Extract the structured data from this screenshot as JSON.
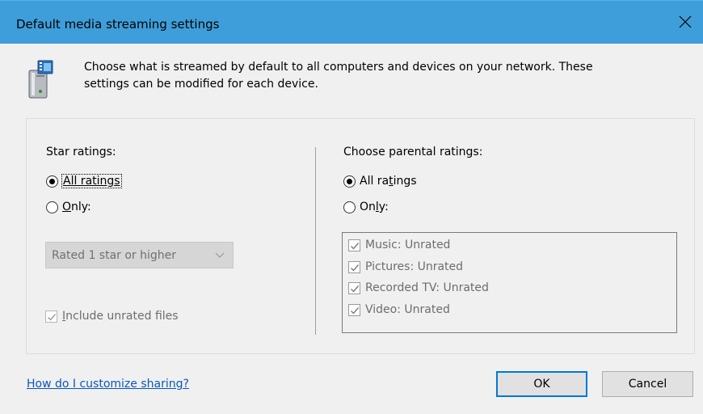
{
  "window": {
    "title": "Default media streaming settings",
    "close_glyph": "✕"
  },
  "header": {
    "icon": "media-device-icon",
    "description_line1": "Choose what is streamed by default to all computers and devices on your network.  These",
    "description_line2": "settings can be modified for each device."
  },
  "star_ratings": {
    "label": "Star ratings:",
    "all_ratings": "All ratings",
    "only": "Only:",
    "only_access_key": "O",
    "only_rest": "nly:",
    "selected": "all_ratings",
    "dropdown_value": "Rated 1 star or higher",
    "include_unrated_label": "Include unrated files",
    "include_unrated_access_key": "I",
    "include_unrated_rest": "nclude unrated files",
    "include_unrated_checked": true
  },
  "parental_ratings": {
    "label": "Choose parental ratings:",
    "all_ratings_pre": "All ra",
    "all_ratings_key": "t",
    "all_ratings_post": "ings",
    "only_pre": "On",
    "only_key": "l",
    "only_post": "y:",
    "selected": "all_ratings",
    "items": [
      {
        "label": "Music: Unrated",
        "checked": true
      },
      {
        "label": "Pictures: Unrated",
        "checked": true
      },
      {
        "label": "Recorded TV: Unrated",
        "checked": true
      },
      {
        "label": "Video: Unrated",
        "checked": true
      }
    ]
  },
  "footer": {
    "help_link": "How do I customize sharing?",
    "ok": "OK",
    "cancel": "Cancel"
  },
  "colors": {
    "titlebar": "#3e9ed9",
    "background": "#f0f0f0",
    "link": "#0a58b9",
    "default_button_border": "#0078d7"
  }
}
